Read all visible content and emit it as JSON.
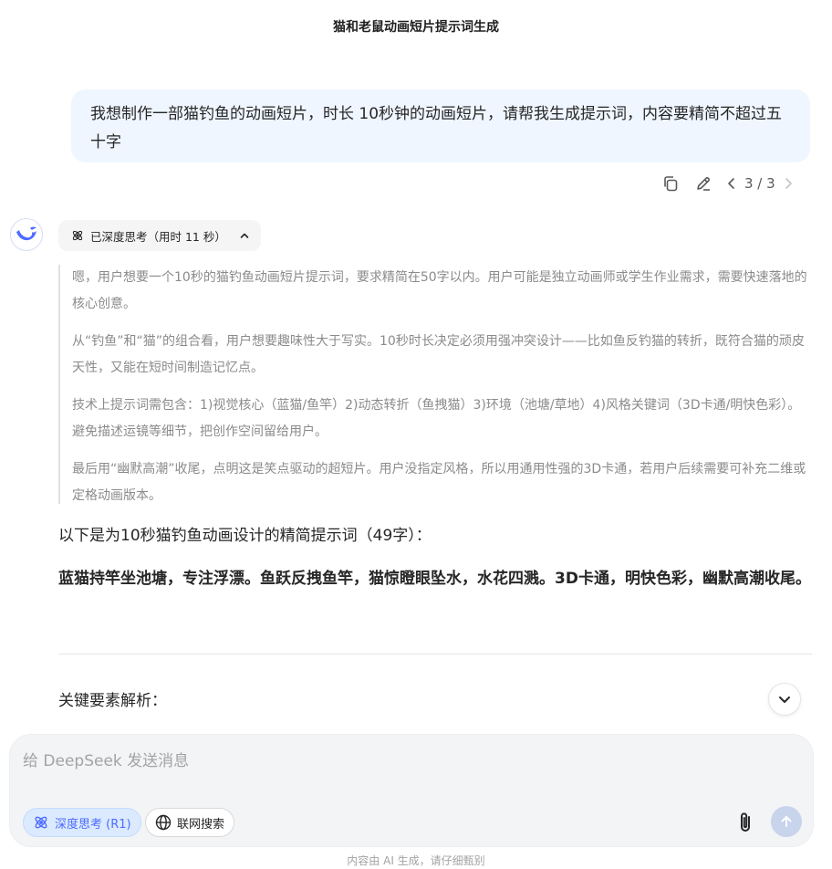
{
  "header": {
    "title": "猫和老鼠动画短片提示词生成"
  },
  "user_message": {
    "text": "我想制作一部猫钓鱼的动画短片，时长 10秒钟的动画短片，请帮我生成提示词，内容要精简不超过五十字",
    "actions": {
      "copy_icon": "copy-icon",
      "edit_icon": "pencil-icon"
    },
    "pager": "3 / 3"
  },
  "assistant": {
    "avatar_icon": "deepseek-whale-icon",
    "thinking_label": "已深度思考（用时 11 秒）",
    "thinking_paragraphs": [
      "嗯，用户想要一个10秒的猫钓鱼动画短片提示词，要求精简在50字以内。用户可能是独立动画师或学生作业需求，需要快速落地的核心创意。",
      "从“钓鱼”和“猫”的组合看，用户想要趣味性大于写实。10秒时长决定必须用强冲突设计——比如鱼反钓猫的转折，既符合猫的顽皮天性，又能在短时间制造记忆点。",
      "技术上提示词需包含：1)视觉核心（蓝猫/鱼竿）2)动态转折（鱼拽猫）3)环境（池塘/草地）4)风格关键词（3D卡通/明快色彩）。避免描述运镜等细节，把创作空间留给用户。",
      "最后用“幽默高潮”收尾，点明这是笑点驱动的超短片。用户没指定风格，所以用通用性强的3D卡通，若用户后续需要可补充二维或定格动画版本。"
    ],
    "answer_intro": "以下是为10秒猫钓鱼动画设计的精简提示词（49字）：",
    "answer_prompt": "蓝猫持竿坐池塘，专注浮漂。鱼跃反拽鱼竿，猫惊瞪眼坠水，水花四溅。3D卡通，明快色彩，幽默高潮收尾。",
    "section_title": "关键要素解析："
  },
  "composer": {
    "placeholder": "给 DeepSeek 发送消息",
    "value": "",
    "deep_think_label": "深度思考 (R1)",
    "web_search_label": "联网搜索",
    "accent_color": "#4d6bfe"
  },
  "footer": {
    "disclaimer": "内容由 AI 生成，请仔细甄别"
  }
}
